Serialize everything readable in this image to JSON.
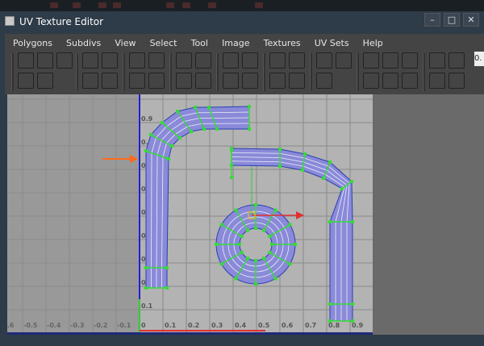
{
  "window": {
    "title": "UV Texture Editor",
    "controls": [
      "–",
      "□",
      "✕"
    ]
  },
  "menu": [
    "Polygons",
    "Subdivs",
    "View",
    "Select",
    "Tool",
    "Image",
    "Textures",
    "UV Sets",
    "Help"
  ],
  "toolbar": {
    "buttons": [
      {
        "icon": "grid-select-icon",
        "color": "#3355aa"
      },
      {
        "icon": "move-uv-icon",
        "color": "#2244aa"
      },
      {
        "icon": "select-shell-icon",
        "color": "#224488"
      },
      {
        "icon": "flip-u-icon",
        "color": "#555555"
      },
      {
        "icon": "flip-v-icon",
        "color": "#555555"
      },
      {
        "icon": "rotate-ccw-icon",
        "color": "#777777"
      },
      {
        "icon": "rotate-cw-icon",
        "color": "#555555"
      },
      {
        "icon": "cut-uv-icon",
        "color": "#555555"
      },
      {
        "icon": "sew-uv-icon",
        "color": "#2233bb"
      },
      {
        "icon": "layout-uv-icon",
        "color": "#3355aa"
      },
      {
        "icon": "align-uv-icon",
        "color": "#555555"
      },
      {
        "icon": "move-sew-icon",
        "color": "#555555"
      },
      {
        "icon": "grid-uv-icon",
        "color": "#555555"
      },
      {
        "icon": "display-image-icon",
        "color": "#8899cc"
      },
      {
        "icon": "checker-icon",
        "color": "#333333"
      },
      {
        "icon": "grid-toggle-icon",
        "color": "#666666"
      },
      {
        "icon": "magnet-snap-icon",
        "color": "#555555"
      },
      {
        "icon": "frame-icon",
        "color": "#4466aa"
      },
      {
        "icon": "uv-snapshot-icon",
        "color": "#555555"
      },
      {
        "icon": "psd-network-icon",
        "color": "#555555"
      }
    ],
    "spin_value": "0."
  },
  "uv_editor": {
    "v_labels": [
      "0.9",
      "0.8",
      "0.7",
      "0.6",
      "0.5",
      "0.4",
      "0.3",
      "0.2",
      "0.1"
    ],
    "u_labels_neg": [
      "-0.6",
      "-0.5",
      "-0.4",
      "-0.3",
      "-0.2",
      "-0.1"
    ],
    "u_labels_pos": [
      "0",
      "0.1",
      "0.2",
      "0.3",
      "0.4",
      "0.5",
      "0.6",
      "0.7",
      "0.8",
      "0.9",
      "1"
    ],
    "colors": {
      "shell_fill": "#8a8ad9",
      "shell_edge": "#2a3fb0",
      "uv_point": "#33dd33",
      "u_axis": "#e03030",
      "v_axis": "#2020cc",
      "annotation_arrow": "#ff6a1a"
    }
  }
}
